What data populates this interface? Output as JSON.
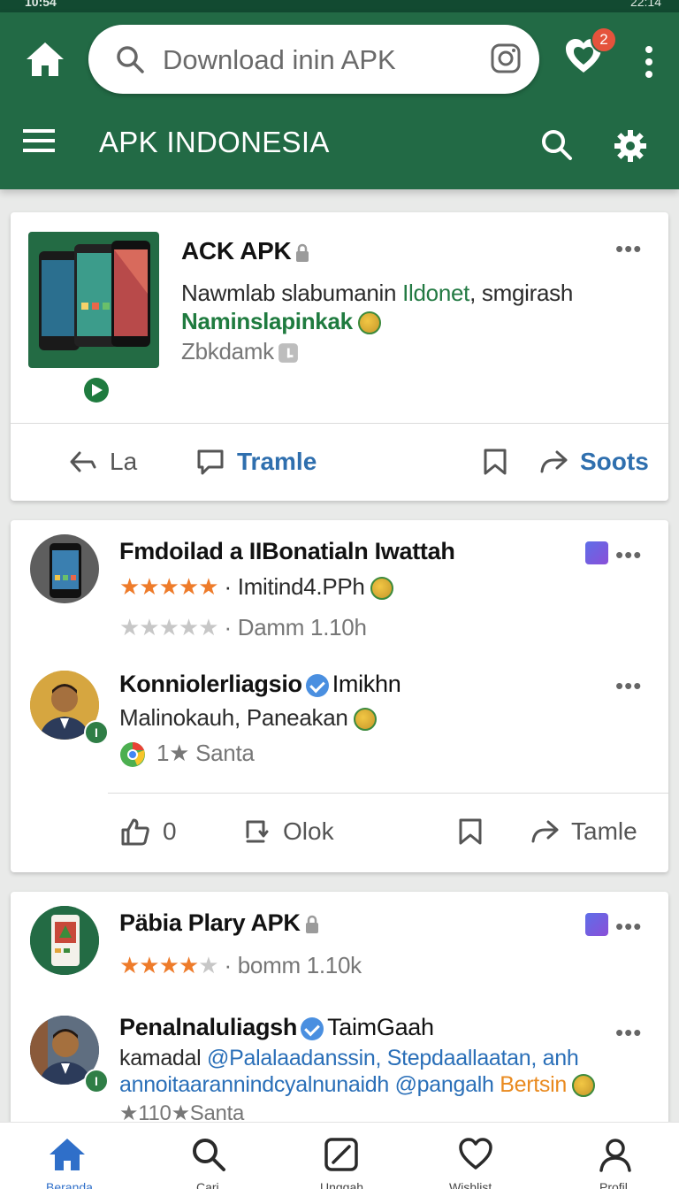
{
  "statusbar": {
    "left": "10:54",
    "right": "22:14"
  },
  "appbar": {
    "search_placeholder": "Download inin APK",
    "notification_count": "2",
    "brand": "APK INDONESIA"
  },
  "card1": {
    "title": "ACK APK",
    "line1_a": "Nawmlab slabumanin ",
    "line1_b": "Ildonet",
    "line1_c": ", smgirash",
    "line2": "Naminslapinkak",
    "line3": "Zbkdamk",
    "actions": {
      "a1": "La",
      "a2": "Tramle",
      "a4": "Soots"
    }
  },
  "card2": {
    "post1": {
      "title": "Fmdoilad a IIBonatialn Iwattah",
      "rating_text": "Imitind4.PPh",
      "line3": "Damm 1.10h"
    },
    "post2": {
      "name": "Konniolerliagsio",
      "tag": "Imikhn",
      "line2": "Malinokauh, Paneakan",
      "line3": "1★ Santa"
    },
    "actions": {
      "a1": "0",
      "a2": "Olok",
      "a4": "Tamle"
    }
  },
  "card3": {
    "post1": {
      "title": "Päbia Plary APK",
      "line2": "bomm 1.10k"
    },
    "post2": {
      "name": "Penalnaluliagsh",
      "tag": "TaimGaah",
      "line2_a": "kamadal ",
      "line2_b": "@Palalaadanssin, Stepdaallaatan, anh",
      "line3_a": "annoitaarannindcyalnunaidh @pangalh ",
      "line3_b": "Bertsin",
      "line4": "★110★Santa"
    }
  },
  "bottomnav": {
    "home": "Beranda",
    "search": "Cari",
    "upload": "Unggah",
    "wishlist": "Wishlist",
    "profile": "Profil"
  },
  "colors": {
    "appbar": "#226a45",
    "accent_blue": "#2f6fae",
    "star": "#ee7b2a",
    "badge": "#e5533c"
  }
}
